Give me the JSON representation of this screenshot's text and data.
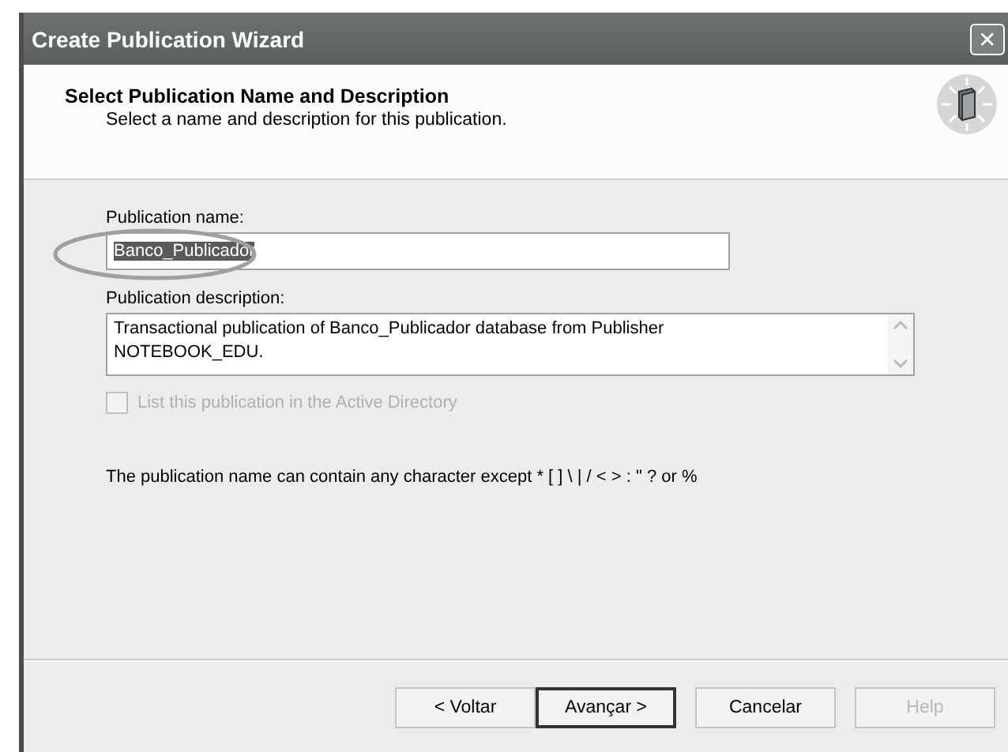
{
  "window": {
    "title": "Create Publication Wizard",
    "close": "✕"
  },
  "header": {
    "title": "Select Publication Name and Description",
    "subtitle": "Select a name and description for this publication."
  },
  "name_field": {
    "label": "Publication name:",
    "value": "Banco_Publicador",
    "selected": true,
    "circled": true
  },
  "description_field": {
    "label": "Publication description:",
    "value": "Transactional publication of Banco_Publicador database from Publisher\nNOTEBOOK_EDU."
  },
  "active_directory": {
    "label": "List this publication in the Active Directory",
    "checked": false,
    "disabled": true
  },
  "note": "The publication name can contain any character except * [ ] \\ | / < > : \" ? or %",
  "buttons": [
    {
      "label": "< Voltar",
      "default": false,
      "disabled": false
    },
    {
      "label": "Avançar >",
      "default": true,
      "disabled": false
    },
    {
      "label": "Cancelar",
      "default": false,
      "disabled": false
    },
    {
      "label": "Help",
      "default": false,
      "disabled": true
    }
  ]
}
